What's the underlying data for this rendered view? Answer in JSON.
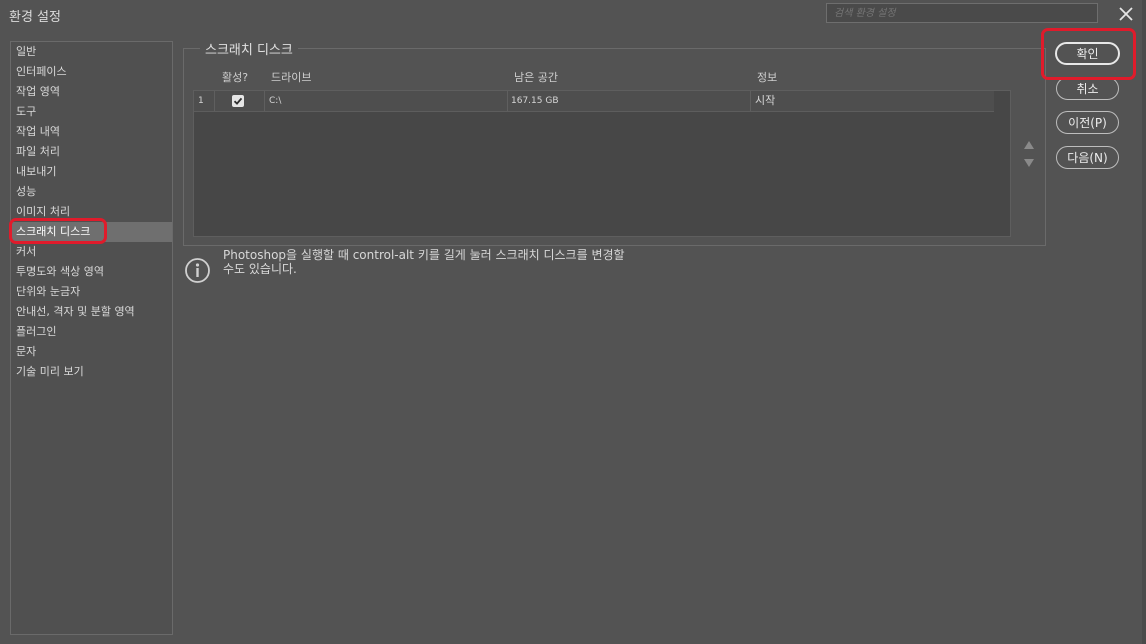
{
  "window": {
    "title": "환경 설정"
  },
  "search": {
    "placeholder": "검색 환경 설정"
  },
  "sidebar": {
    "selected": "스크래치 디스크",
    "items": [
      "일반",
      "인터페이스",
      "작업 영역",
      "도구",
      "작업 내역",
      "파일 처리",
      "내보내기",
      "성능",
      "이미지 처리",
      "스크래치 디스크",
      "커서",
      "투명도와 색상 영역",
      "단위와 눈금자",
      "안내선, 격자 및 분할 영역",
      "플러그인",
      "문자",
      "기술 미리 보기"
    ]
  },
  "scratch_disks": {
    "title": "스크래치 디스크",
    "columns": {
      "active": "활성?",
      "drive": "드라이브",
      "free_space": "남은 공간",
      "info": "정보"
    },
    "rows": [
      {
        "index": "1",
        "active": true,
        "drive": "C:\\",
        "free_space": "167.15 GB",
        "info": "시작"
      }
    ]
  },
  "info": {
    "line1": "Photoshop을 실행할 때 control-alt 키를 길게 눌러 스크래치 디스크를 변경할",
    "line2": "수도 있습니다."
  },
  "buttons": {
    "ok": "확인",
    "cancel": "취소",
    "prev": "이전(P)",
    "next": "다음(N)"
  },
  "colors": {
    "background": "#535353",
    "highlight": "#e01b2b",
    "selected_item": "#6f6f6f"
  },
  "icons": {
    "close": "close-icon",
    "check": "check-icon",
    "up": "triangle-up-icon",
    "down": "triangle-down-icon",
    "info": "info-icon"
  }
}
